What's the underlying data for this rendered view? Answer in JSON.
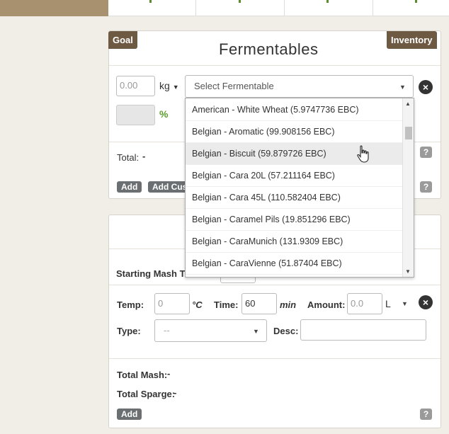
{
  "fermentables": {
    "goal_tab": "Goal",
    "inventory_tab": "Inventory",
    "title": "Fermentables",
    "amount_placeholder": "0.00",
    "unit": "kg",
    "percent_sign": "%",
    "select_placeholder": "Select Fermentable",
    "total_label": "Total:",
    "total_value": "-",
    "add_label": "Add",
    "add_custom_label": "Add Cus",
    "help_label": "?",
    "close_label": "×"
  },
  "dropdown": {
    "items": [
      "American - White Wheat (5.9747736 EBC)",
      "Belgian - Aromatic (99.908156 EBC)",
      "Belgian - Biscuit (59.879726 EBC)",
      "Belgian - Cara 20L (57.211164 EBC)",
      "Belgian - Cara 45L (110.582404 EBC)",
      "Belgian - Caramel Pils (19.851296 EBC)",
      "Belgian - CaraMunich (131.9309 EBC)",
      "Belgian - CaraVienne (51.87404 EBC)"
    ],
    "hovered_index": 2
  },
  "mash": {
    "starting_label": "Starting Mash Th",
    "temp_label": "Temp:",
    "temp_placeholder": "0",
    "temp_unit": "°C",
    "time_label": "Time:",
    "time_value": "60",
    "time_unit": "min",
    "amount_label": "Amount:",
    "amount_placeholder": "0.0",
    "amount_unit": "L",
    "type_label": "Type:",
    "type_placeholder": "--",
    "desc_label": "Desc:",
    "total_mash_label": "Total Mash:",
    "total_mash_value": "-",
    "total_sparge_label": "Total Sparge:",
    "total_sparge_value": "-",
    "add_label": "Add",
    "help_label": "?",
    "close_label": "×"
  }
}
